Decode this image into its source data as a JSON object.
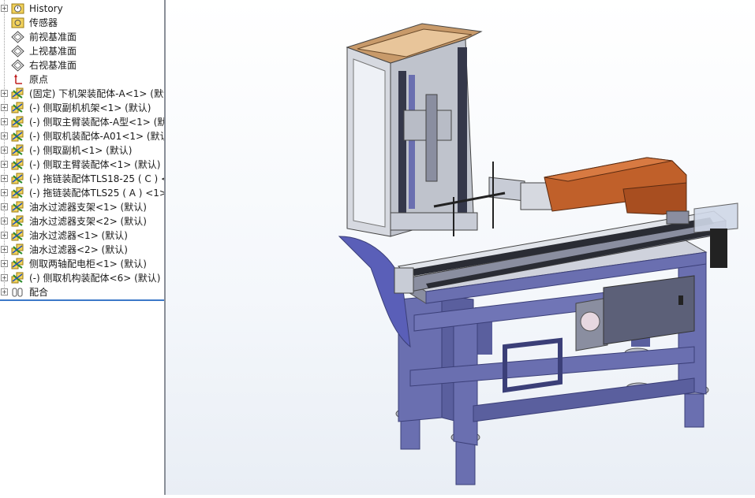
{
  "feature_tree": {
    "items": [
      {
        "label": "History",
        "icon": "history-icon",
        "expandable": true
      },
      {
        "label": "传感器",
        "icon": "sensor-icon",
        "expandable": false
      },
      {
        "label": "前视基准面",
        "icon": "plane-icon",
        "expandable": false
      },
      {
        "label": "上视基准面",
        "icon": "plane-icon",
        "expandable": false
      },
      {
        "label": "右视基准面",
        "icon": "plane-icon",
        "expandable": false
      },
      {
        "label": "原点",
        "icon": "origin-icon",
        "expandable": false
      },
      {
        "label": "(固定) 下机架装配体-A<1> (默认",
        "icon": "assembly-icon",
        "expandable": true
      },
      {
        "label": "(-) 侧取副机机架<1> (默认)",
        "icon": "assembly-icon",
        "expandable": true
      },
      {
        "label": "(-) 侧取主臂装配体-A型<1> (默",
        "icon": "assembly-icon",
        "expandable": true
      },
      {
        "label": "(-) 侧取机装配体-A01<1> (默认",
        "icon": "assembly-icon",
        "expandable": true
      },
      {
        "label": "(-) 侧取副机<1> (默认)",
        "icon": "assembly-icon",
        "expandable": true
      },
      {
        "label": "(-) 侧取主臂装配体<1> (默认)",
        "icon": "assembly-icon",
        "expandable": true
      },
      {
        "label": "(-) 拖链装配体TLS18-25 ( C ) <",
        "icon": "assembly-icon",
        "expandable": true
      },
      {
        "label": "(-) 拖链装配体TLS25 ( A ) <1>",
        "icon": "assembly-icon",
        "expandable": true
      },
      {
        "label": "油水过滤器支架<1> (默认)",
        "icon": "assembly-icon",
        "expandable": true
      },
      {
        "label": "油水过滤器支架<2> (默认)",
        "icon": "assembly-icon",
        "expandable": true
      },
      {
        "label": "油水过滤器<1> (默认)",
        "icon": "assembly-icon",
        "expandable": true
      },
      {
        "label": "油水过滤器<2> (默认)",
        "icon": "assembly-icon",
        "expandable": true
      },
      {
        "label": "侧取两轴配电柜<1> (默认)",
        "icon": "assembly-icon",
        "expandable": true
      },
      {
        "label": "(-) 侧取机构装配体<6> (默认)",
        "icon": "assembly-icon",
        "expandable": true
      },
      {
        "label": "配合",
        "icon": "mates-icon",
        "expandable": true
      }
    ]
  },
  "colors": {
    "frame": "#6a6fb0",
    "frame_dark": "#4d5290",
    "arm": "#c0602a",
    "housing": "#9a9ea8",
    "selection_line": "#3c78c8"
  }
}
